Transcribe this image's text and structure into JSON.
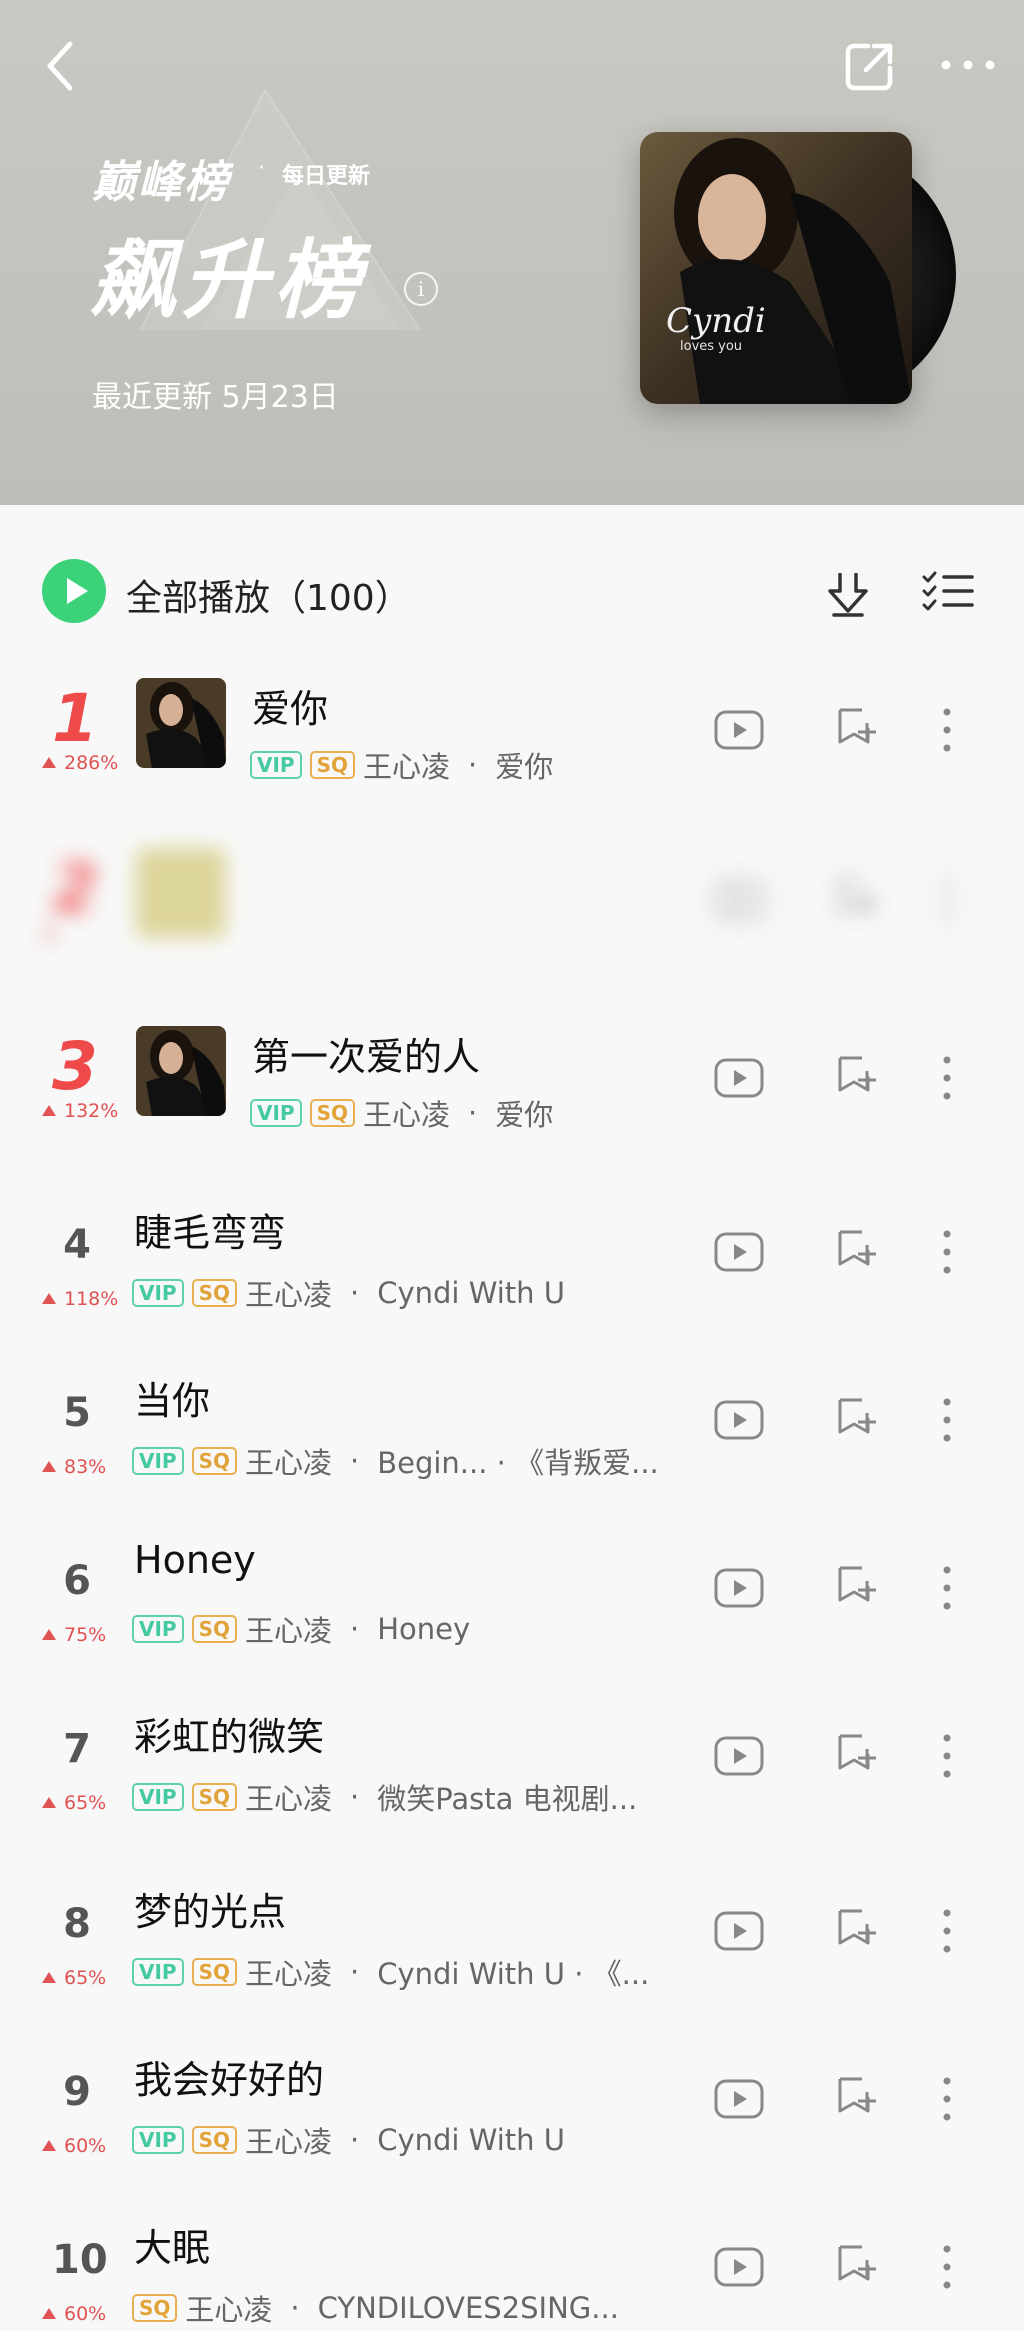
{
  "header": {
    "brand": "巅峰榜",
    "brand_dot": "·",
    "daily": "每日更新",
    "title": "飙升榜",
    "info": "i",
    "updated": "最近更新 5月23日"
  },
  "toolbar": {
    "play_all_label": "全部播放（100）"
  },
  "colors": {
    "accent_green": "#3cd27a",
    "rank_red": "#ef4a4a",
    "vip_teal": "#45c9a2",
    "sq_gold": "#e2a33a"
  },
  "songs": [
    {
      "rank": "1",
      "trend": "286%",
      "title": "爱你",
      "vip": "VIP",
      "sq": "SQ",
      "artist": "王心凌",
      "sep": "·",
      "album": "爱你"
    },
    {
      "rank": "2",
      "trend": "",
      "title": "",
      "vip": "",
      "sq": "",
      "artist": "",
      "sep": "",
      "album": ""
    },
    {
      "rank": "3",
      "trend": "132%",
      "title": "第一次爱的人",
      "vip": "VIP",
      "sq": "SQ",
      "artist": "王心凌",
      "sep": "·",
      "album": "爱你"
    },
    {
      "rank": "4",
      "trend": "118%",
      "title": "睫毛弯弯",
      "vip": "VIP",
      "sq": "SQ",
      "artist": "王心凌",
      "sep": "·",
      "album": "Cyndi With U"
    },
    {
      "rank": "5",
      "trend": "83%",
      "title": "当你",
      "vip": "VIP",
      "sq": "SQ",
      "artist": "王心凌",
      "sep": "·",
      "album": "Begin... · 《背叛爱..."
    },
    {
      "rank": "6",
      "trend": "75%",
      "title": "Honey",
      "vip": "VIP",
      "sq": "SQ",
      "artist": "王心凌",
      "sep": "·",
      "album": "Honey"
    },
    {
      "rank": "7",
      "trend": "65%",
      "title": "彩虹的微笑",
      "vip": "VIP",
      "sq": "SQ",
      "artist": "王心凌",
      "sep": "·",
      "album": "微笑Pasta 电视剧..."
    },
    {
      "rank": "8",
      "trend": "65%",
      "title": "梦的光点",
      "vip": "VIP",
      "sq": "SQ",
      "artist": "王心凌",
      "sep": "·",
      "album": "Cyndi With U · 《..."
    },
    {
      "rank": "9",
      "trend": "60%",
      "title": "我会好好的",
      "vip": "VIP",
      "sq": "SQ",
      "artist": "王心凌",
      "sep": "·",
      "album": "Cyndi With U"
    },
    {
      "rank": "10",
      "trend": "60%",
      "title": "大眠",
      "vip": "",
      "sq": "SQ",
      "artist": "王心凌",
      "sep": "·",
      "album": "CYNDILOVES2SING..."
    }
  ]
}
